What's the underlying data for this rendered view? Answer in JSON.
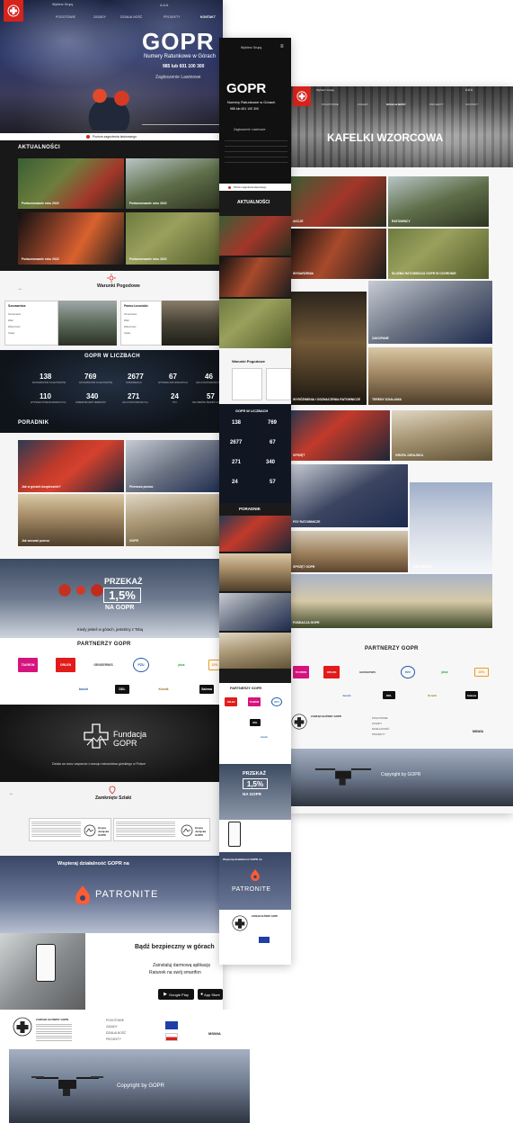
{
  "header": {
    "group_select": "Wybierz Grupę",
    "a_sizes": "A A A",
    "nav": [
      "POGOTOWIE",
      "ZASADY",
      "DZIAŁALNOŚĆ",
      "PROJEKTY",
      "KONTAKT"
    ],
    "brand": "GOPR",
    "tagline": "Numery Ratunkowe w Górach",
    "phones": "985 lub 601 100 300",
    "signup": "Zagłoszenie Lawinowe",
    "warning": "Poziom zagrożenia lawinowego"
  },
  "sections": {
    "news": "AKTUALNOŚCI",
    "weather": "Warunki Pogodowe",
    "numbers": "GOPR W LICZBACH",
    "guide": "PORADNIK",
    "partners": "PARTNERZY GOPR",
    "fund": "Fundacja GOPR",
    "fund_sub": "Działa na rzecz wsparcia i rozwoju ratownictwa górskiego w Polsce",
    "closed": "Zamknięte Szlaki",
    "support": "Wspieraj działalność GOPR na",
    "patronite": "PATRONITE",
    "safe_title": "Bądź bezpieczny w górach",
    "safe_sub1": "Zainstaluj darmową aplikację",
    "safe_sub2": "Ratunek na swój smartfon",
    "google_play": "Google Play",
    "app_store": "App Store",
    "tiles_title": "KAFELKI WZORCOWA",
    "promo_text": "Kiedy jesteś w górach, jesteśmy z Tobą",
    "promo_1": "PRZEKAŻ",
    "promo_2": "1,5%",
    "promo_3": "NA GOPR",
    "footer_copy": "Copyright by GOPR"
  },
  "news": [
    {
      "label": "Podsumowanie roku 2022"
    },
    {
      "label": "Podsumowanie roku 2022"
    },
    {
      "label": "Podsumowanie roku 2022"
    },
    {
      "label": "Podsumowanie roku 2022"
    }
  ],
  "weather": [
    {
      "place": "Szczawnica",
      "rows": [
        "Temperatura",
        "Wiatr",
        "Widoczność",
        "Opady"
      ]
    },
    {
      "place": "Pasmo Łosośskie",
      "rows": [
        "Temperatura",
        "Wiatr",
        "Widoczność",
        "Opady"
      ]
    }
  ],
  "stats": [
    {
      "n": "138",
      "l": "RATOWNIKÓW OCHOTNIKÓW"
    },
    {
      "n": "769",
      "l": "RATOWNIKÓW OCHOTNIKÓW"
    },
    {
      "n": "2677",
      "l": "INTERWENCJI"
    },
    {
      "n": "67",
      "l": "WYPRAW RATUNKOWYCH"
    },
    {
      "n": "46",
      "l": "AKCJI RATUNKOWYCH"
    },
    {
      "n": "110",
      "l": "WYPRAW POSZUKIWAWCZYCH"
    },
    {
      "n": "340",
      "l": "ZABEZPIECZEŃ TERENÓW"
    },
    {
      "n": "271",
      "l": "AKCJI RATUNKOWYCH"
    },
    {
      "n": "24",
      "l": "PSY"
    },
    {
      "n": "57",
      "l": "SKUTERÓW ŚNIEŻNYCH"
    }
  ],
  "guide": [
    {
      "label": "Jak w górach bezpiecznie?"
    },
    {
      "label": "Pierwsza pomoc"
    },
    {
      "label": "Jak wezwać pomoc"
    },
    {
      "label": "GOPR"
    }
  ],
  "partners": [
    "TAURON",
    "ORLEN",
    "GENSERWIS",
    "PZU",
    "plus",
    "15%",
    "bosch",
    "DDL",
    "Kronik",
    "Salewa"
  ],
  "tiles": [
    {
      "label": "AKCJE"
    },
    {
      "label": "RATOWNICY"
    },
    {
      "label": "WYDARZENIA"
    },
    {
      "label": "SŁUŻBA RATOWNICZA GOPR W OCHRONIE"
    },
    {
      "label": "ZAKOPANE"
    },
    {
      "label": "SZKOLENIA"
    },
    {
      "label": "WYRÓŻNIENIA I ODZNACZENIA RATOWNICZE"
    },
    {
      "label": "TERENY DZIAŁANIA"
    },
    {
      "label": "SPRZĘT"
    },
    {
      "label": "GRUPA JURAJSKA"
    },
    {
      "label": "PSY RATOWNICZE"
    },
    {
      "label": "FUNDACJA GOPR"
    },
    {
      "label": "SPRZĘT GOPR"
    },
    {
      "label": "MULTIMEDIA"
    }
  ],
  "footer": {
    "org": "ZARZĄD GŁÓWNY GOPR",
    "links": [
      "POGOTOWIE",
      "ZASADY",
      "DZIAŁALNOŚĆ",
      "PROJEKTY"
    ],
    "gov": [
      "MSWiA",
      "Unia Europejska",
      "Rzeczpospolita Polska"
    ]
  }
}
